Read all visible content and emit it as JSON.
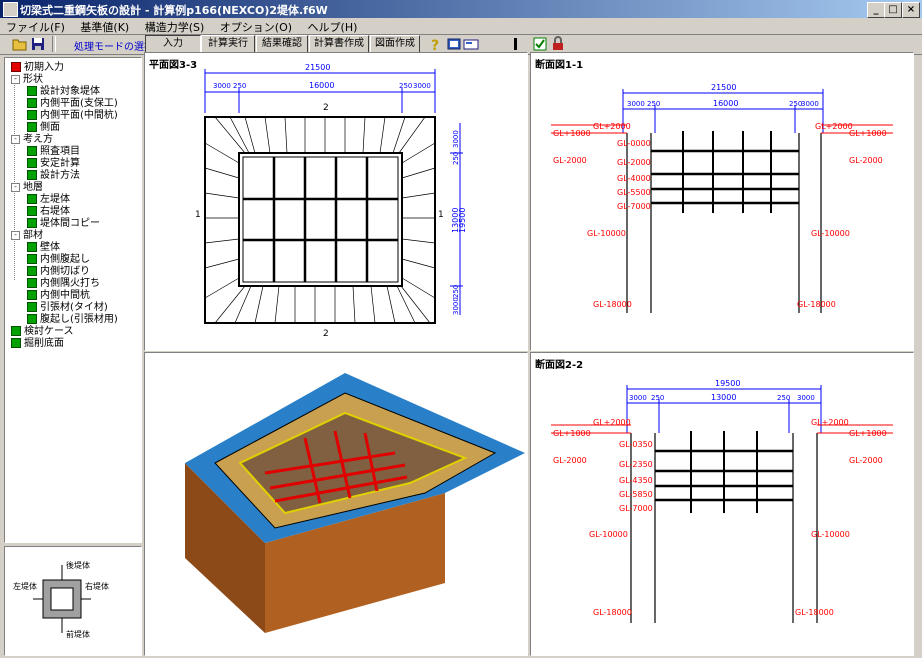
{
  "app": {
    "title": "切梁式二重鋼矢板の設計 - 計算例p166(NEXCO)2堤体.f6W",
    "window_buttons": [
      "_",
      "□",
      "×"
    ]
  },
  "menu": [
    "ファイル(F)",
    "基準値(K)",
    "構造力学(S)",
    "オプション(O)",
    "ヘルプ(H)"
  ],
  "toolbar": {
    "mode_label": "処理モードの選択",
    "buttons": [
      "入力",
      "計算実行",
      "結果確認",
      "計算書作成",
      "図面作成"
    ]
  },
  "tree": [
    {
      "label": "初期入力",
      "level": 0,
      "check": "red",
      "expand": ""
    },
    {
      "label": "形状",
      "level": 0,
      "check": "",
      "expand": "-"
    },
    {
      "label": "設計対象堤体",
      "level": 1,
      "check": "green",
      "expand": ""
    },
    {
      "label": "内側平面(支保工)",
      "level": 1,
      "check": "green",
      "expand": ""
    },
    {
      "label": "内側平面(中間杭)",
      "level": 1,
      "check": "green",
      "expand": ""
    },
    {
      "label": "側面",
      "level": 1,
      "check": "green",
      "expand": ""
    },
    {
      "label": "考え方",
      "level": 0,
      "check": "",
      "expand": "-"
    },
    {
      "label": "照査項目",
      "level": 1,
      "check": "green",
      "expand": ""
    },
    {
      "label": "安定計算",
      "level": 1,
      "check": "green",
      "expand": ""
    },
    {
      "label": "設計方法",
      "level": 1,
      "check": "green",
      "expand": ""
    },
    {
      "label": "地層",
      "level": 0,
      "check": "",
      "expand": "-"
    },
    {
      "label": "左堤体",
      "level": 1,
      "check": "green",
      "expand": ""
    },
    {
      "label": "右堤体",
      "level": 1,
      "check": "green",
      "expand": ""
    },
    {
      "label": "堤体間コピー",
      "level": 1,
      "check": "green",
      "expand": ""
    },
    {
      "label": "部材",
      "level": 0,
      "check": "",
      "expand": "-"
    },
    {
      "label": "壁体",
      "level": 1,
      "check": "green",
      "expand": ""
    },
    {
      "label": "内側腹起し",
      "level": 1,
      "check": "green",
      "expand": ""
    },
    {
      "label": "内側切ばり",
      "level": 1,
      "check": "green",
      "expand": ""
    },
    {
      "label": "内側隅火打ち",
      "level": 1,
      "check": "green",
      "expand": ""
    },
    {
      "label": "内側中間杭",
      "level": 1,
      "check": "green",
      "expand": ""
    },
    {
      "label": "引張材(タイ材)",
      "level": 1,
      "check": "green",
      "expand": ""
    },
    {
      "label": "腹起し(引張材用)",
      "level": 1,
      "check": "green",
      "expand": ""
    },
    {
      "label": "検討ケース",
      "level": 0,
      "check": "green",
      "expand": ""
    },
    {
      "label": "掘削底面",
      "level": 0,
      "check": "green",
      "expand": ""
    }
  ],
  "mini_diagram": {
    "top": "後堤体",
    "left": "左堤体",
    "right": "右堤体",
    "bottom": "前堤体"
  },
  "plan_view": {
    "title": "平面図3-3",
    "dims_top_total": "21500",
    "dims_top": [
      "3000",
      "250",
      "16000",
      "250",
      "3000"
    ],
    "dims_right": [
      "3000",
      "250",
      "13000",
      "250",
      "3000"
    ],
    "dim_right_total": "19500",
    "section_marks": [
      "2",
      "1",
      "1",
      "2"
    ]
  },
  "section_1": {
    "title": "断面図1-1",
    "dim_total": "21500",
    "dims": [
      "3000",
      "250",
      "16000",
      "250",
      "3000"
    ],
    "levels": [
      "GL+2000",
      "GL+1000",
      "GL-0000",
      "GL-2000",
      "GL-2000",
      "GL-4000",
      "GL-5500",
      "GL-7000",
      "GL-10000",
      "GL-18000"
    ]
  },
  "section_2": {
    "title": "断面図2-2",
    "dim_total": "19500",
    "dims": [
      "3000",
      "250",
      "13000",
      "250",
      "3000"
    ],
    "levels": [
      "GL+2000",
      "GL+1000",
      "GL-0350",
      "GL-2000",
      "GL-2350",
      "GL-4350",
      "GL-5850",
      "GL-7000",
      "GL-10000",
      "GL-18000"
    ]
  },
  "colors": {
    "accent": "#0a246a",
    "level_red": "#ff0000",
    "dim_blue": "#0000ff",
    "check_green": "#00a000"
  }
}
